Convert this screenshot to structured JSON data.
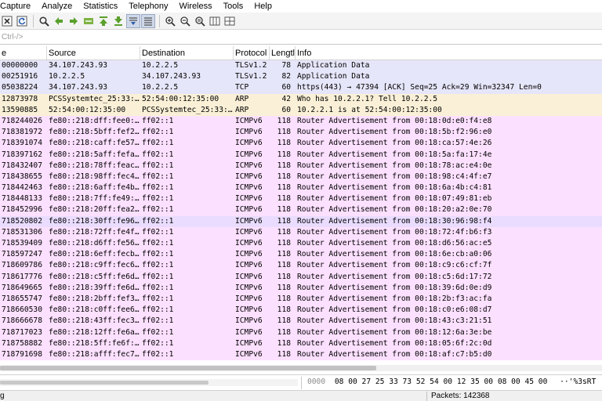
{
  "menu": {
    "items": [
      "Capture",
      "Analyze",
      "Statistics",
      "Telephony",
      "Wireless",
      "Tools",
      "Help"
    ]
  },
  "toolbar": {
    "icons": [
      "close-file-icon",
      "reload-icon",
      "find-packet-icon",
      "go-back-icon",
      "go-forward-icon",
      "go-to-packet-icon",
      "go-first-icon",
      "go-last-icon",
      "autoscroll-icon",
      "colorize-icon",
      "zoom-in-icon",
      "zoom-out-icon",
      "zoom-normal-icon",
      "resize-columns-icon",
      "layout-icon"
    ]
  },
  "filter": {
    "placeholder": "Ctrl-/>"
  },
  "packet_list": {
    "headers": [
      "e",
      "Source",
      "Destination",
      "Protocol",
      "Lengtl",
      "Info"
    ],
    "colors": {
      "tls": "#e6e6fa",
      "tcp": "#e6e6fa",
      "arp": "#faf0d7",
      "icmpv6": "#fce0ff",
      "selected_icmpv6": "#e9dcff"
    },
    "rows": [
      {
        "time": "00000000",
        "src": "34.107.243.93",
        "dst": "10.2.2.5",
        "proto": "TLSv1.2",
        "len": "78",
        "info": "Application Data",
        "color": "#e6e6fa"
      },
      {
        "time": "00251916",
        "src": "10.2.2.5",
        "dst": "34.107.243.93",
        "proto": "TLSv1.2",
        "len": "82",
        "info": "Application Data",
        "color": "#e6e6fa"
      },
      {
        "time": "05038224",
        "src": "34.107.243.93",
        "dst": "10.2.2.5",
        "proto": "TCP",
        "len": "60",
        "info": "https(443) → 47394 [ACK] Seq=25 Ack=29 Win=32347 Len=0",
        "color": "#e6e6fa"
      },
      {
        "time": "12873978",
        "src": "PCSSystemtec_25:33:…",
        "dst": "52:54:00:12:35:00",
        "proto": "ARP",
        "len": "42",
        "info": "Who has 10.2.2.1? Tell 10.2.2.5",
        "color": "#faf0d7"
      },
      {
        "time": "13590885",
        "src": "52:54:00:12:35:00",
        "dst": "PCSSystemtec_25:33:…",
        "proto": "ARP",
        "len": "60",
        "info": "10.2.2.1 is at 52:54:00:12:35:00",
        "color": "#faf0d7"
      },
      {
        "time": "718244026",
        "src": "fe80::218:dff:fee0:…",
        "dst": "ff02::1",
        "proto": "ICMPv6",
        "len": "118",
        "info": "Router Advertisement from 00:18:0d:e0:f4:e8",
        "color": "#fce0ff"
      },
      {
        "time": "718381972",
        "src": "fe80::218:5bff:fef2…",
        "dst": "ff02::1",
        "proto": "ICMPv6",
        "len": "118",
        "info": "Router Advertisement from 00:18:5b:f2:96:e0",
        "color": "#fce0ff"
      },
      {
        "time": "718391074",
        "src": "fe80::218:caff:fe57…",
        "dst": "ff02::1",
        "proto": "ICMPv6",
        "len": "118",
        "info": "Router Advertisement from 00:18:ca:57:4e:26",
        "color": "#fce0ff"
      },
      {
        "time": "718397162",
        "src": "fe80::218:5aff:fefa…",
        "dst": "ff02::1",
        "proto": "ICMPv6",
        "len": "118",
        "info": "Router Advertisement from 00:18:5a:fa:17:4e",
        "color": "#fce0ff"
      },
      {
        "time": "718432407",
        "src": "fe80::218:78ff:feac…",
        "dst": "ff02::1",
        "proto": "ICMPv6",
        "len": "118",
        "info": "Router Advertisement from 00:18:78:ac:e4:0e",
        "color": "#fce0ff"
      },
      {
        "time": "718438655",
        "src": "fe80::218:98ff:fec4…",
        "dst": "ff02::1",
        "proto": "ICMPv6",
        "len": "118",
        "info": "Router Advertisement from 00:18:98:c4:4f:e7",
        "color": "#fce0ff"
      },
      {
        "time": "718442463",
        "src": "fe80::218:6aff:fe4b…",
        "dst": "ff02::1",
        "proto": "ICMPv6",
        "len": "118",
        "info": "Router Advertisement from 00:18:6a:4b:c4:81",
        "color": "#fce0ff"
      },
      {
        "time": "718448133",
        "src": "fe80::218:7ff:fe49:…",
        "dst": "ff02::1",
        "proto": "ICMPv6",
        "len": "118",
        "info": "Router Advertisement from 00:18:07:49:81:eb",
        "color": "#fce0ff"
      },
      {
        "time": "718452996",
        "src": "fe80::218:20ff:fea2…",
        "dst": "ff02::1",
        "proto": "ICMPv6",
        "len": "118",
        "info": "Router Advertisement from 00:18:20:a2:0e:70",
        "color": "#fce0ff"
      },
      {
        "time": "718520802",
        "src": "fe80::218:30ff:fe96…",
        "dst": "ff02::1",
        "proto": "ICMPv6",
        "len": "118",
        "info": "Router Advertisement from 00:18:30:96:98:f4",
        "color": "#e9dcff"
      },
      {
        "time": "718531306",
        "src": "fe80::218:72ff:fe4f…",
        "dst": "ff02::1",
        "proto": "ICMPv6",
        "len": "118",
        "info": "Router Advertisement from 00:18:72:4f:b6:f3",
        "color": "#fce0ff"
      },
      {
        "time": "718539409",
        "src": "fe80::218:d6ff:fe56…",
        "dst": "ff02::1",
        "proto": "ICMPv6",
        "len": "118",
        "info": "Router Advertisement from 00:18:d6:56:ac:e5",
        "color": "#fce0ff"
      },
      {
        "time": "718597247",
        "src": "fe80::218:6eff:fecb…",
        "dst": "ff02::1",
        "proto": "ICMPv6",
        "len": "118",
        "info": "Router Advertisement from 00:18:6e:cb:a0:06",
        "color": "#fce0ff"
      },
      {
        "time": "718609786",
        "src": "fe80::218:c9ff:fec6…",
        "dst": "ff02::1",
        "proto": "ICMPv6",
        "len": "118",
        "info": "Router Advertisement from 00:18:c9:c6:cf:7f",
        "color": "#fce0ff"
      },
      {
        "time": "718617776",
        "src": "fe80::218:c5ff:fe6d…",
        "dst": "ff02::1",
        "proto": "ICMPv6",
        "len": "118",
        "info": "Router Advertisement from 00:18:c5:6d:17:72",
        "color": "#fce0ff"
      },
      {
        "time": "718649665",
        "src": "fe80::218:39ff:fe6d…",
        "dst": "ff02::1",
        "proto": "ICMPv6",
        "len": "118",
        "info": "Router Advertisement from 00:18:39:6d:0e:d9",
        "color": "#fce0ff"
      },
      {
        "time": "718655747",
        "src": "fe80::218:2bff:fef3…",
        "dst": "ff02::1",
        "proto": "ICMPv6",
        "len": "118",
        "info": "Router Advertisement from 00:18:2b:f3:ac:fa",
        "color": "#fce0ff"
      },
      {
        "time": "718660530",
        "src": "fe80::218:c0ff:fee6…",
        "dst": "ff02::1",
        "proto": "ICMPv6",
        "len": "118",
        "info": "Router Advertisement from 00:18:c0:e6:08:d7",
        "color": "#fce0ff"
      },
      {
        "time": "718666678",
        "src": "fe80::218:43ff:fec3…",
        "dst": "ff02::1",
        "proto": "ICMPv6",
        "len": "118",
        "info": "Router Advertisement from 00:18:43:c3:21:51",
        "color": "#fce0ff"
      },
      {
        "time": "718717023",
        "src": "fe80::218:12ff:fe6a…",
        "dst": "ff02::1",
        "proto": "ICMPv6",
        "len": "118",
        "info": "Router Advertisement from 00:18:12:6a:3e:be",
        "color": "#fce0ff"
      },
      {
        "time": "718758882",
        "src": "fe80::218:5ff:fe6f:…",
        "dst": "ff02::1",
        "proto": "ICMPv6",
        "len": "118",
        "info": "Router Advertisement from 00:18:05:6f:2c:0d",
        "color": "#fce0ff"
      },
      {
        "time": "718791698",
        "src": "fe80::218:afff:fec7…",
        "dst": "ff02::1",
        "proto": "ICMPv6",
        "len": "118",
        "info": "Router Advertisement from 00:18:af:c7:b5:d0",
        "color": "#fce0ff"
      }
    ]
  },
  "bytes_pane": {
    "offset": "0000",
    "hex": "08 00 27 25 33 73 52 54  00 12 35 00 08 00 45 00",
    "ascii": "··'%3sRT"
  },
  "status": {
    "left": "g",
    "packets": "Packets: 142368"
  }
}
